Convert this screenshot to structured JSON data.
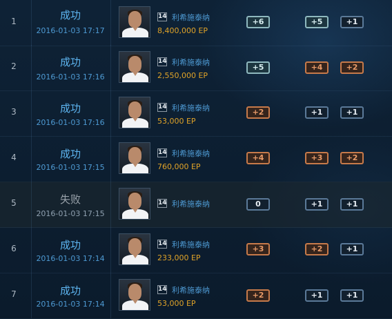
{
  "rows": [
    {
      "index": "1",
      "status": "成功",
      "time": "2016-01-03 17:17",
      "level": "14",
      "player": "利希施泰纳",
      "ep": "8,400,000 EP",
      "badges": [
        {
          "label": "+6",
          "color": "teal"
        },
        {
          "label": "+5",
          "color": "teal"
        },
        {
          "label": "+1",
          "color": "blue"
        }
      ]
    },
    {
      "index": "2",
      "status": "成功",
      "time": "2016-01-03 17:16",
      "level": "14",
      "player": "利希施泰纳",
      "ep": "2,550,000 EP",
      "badges": [
        {
          "label": "+5",
          "color": "teal"
        },
        {
          "label": "+4",
          "color": "orange"
        },
        {
          "label": "+2",
          "color": "orange"
        }
      ]
    },
    {
      "index": "3",
      "status": "成功",
      "time": "2016-01-03 17:16",
      "level": "14",
      "player": "利希施泰纳",
      "ep": "53,000 EP",
      "badges": [
        {
          "label": "+2",
          "color": "orange"
        },
        {
          "label": "+1",
          "color": "blue"
        },
        {
          "label": "+1",
          "color": "blue"
        }
      ]
    },
    {
      "index": "4",
      "status": "成功",
      "time": "2016-01-03 17:15",
      "level": "14",
      "player": "利希施泰纳",
      "ep": "760,000 EP",
      "badges": [
        {
          "label": "+4",
          "color": "orange"
        },
        {
          "label": "+3",
          "color": "orange"
        },
        {
          "label": "+2",
          "color": "orange"
        }
      ]
    },
    {
      "index": "5",
      "status": "失败",
      "time": "2016-01-03 17:15",
      "level": "14",
      "player": "利希施泰纳",
      "ep": "",
      "badges": [
        {
          "label": "0",
          "color": "blue"
        },
        {
          "label": "+1",
          "color": "blue"
        },
        {
          "label": "+1",
          "color": "blue"
        }
      ]
    },
    {
      "index": "6",
      "status": "成功",
      "time": "2016-01-03 17:14",
      "level": "14",
      "player": "利希施泰纳",
      "ep": "233,000 EP",
      "badges": [
        {
          "label": "+3",
          "color": "orange"
        },
        {
          "label": "+2",
          "color": "orange"
        },
        {
          "label": "+1",
          "color": "blue"
        }
      ]
    },
    {
      "index": "7",
      "status": "成功",
      "time": "2016-01-03 17:14",
      "level": "14",
      "player": "利希施泰纳",
      "ep": "53,000 EP",
      "badges": [
        {
          "label": "+2",
          "color": "orange"
        },
        {
          "label": "+1",
          "color": "blue"
        },
        {
          "label": "+1",
          "color": "blue"
        }
      ]
    }
  ],
  "colors": {
    "success": "#5db4ef",
    "fail": "#9aa3ab",
    "ep": "#e0a328",
    "teal_badge": "#8fb9bf",
    "orange_badge": "#c77a4a",
    "blue_badge": "#5b7a99"
  },
  "icons": {
    "avatar": "player-avatar",
    "level": "level-badge-icon"
  }
}
